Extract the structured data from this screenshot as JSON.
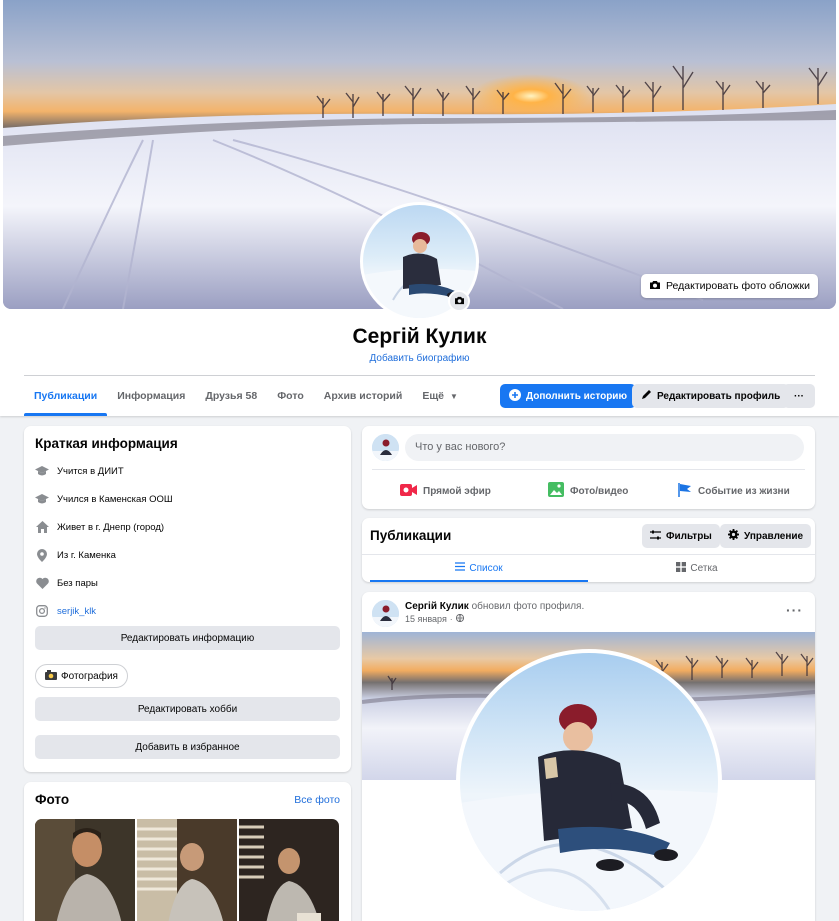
{
  "profile": {
    "name": "Сергій Кулик",
    "bio_link": "Добавить биографию",
    "edit_cover_label": "Редактировать фото обложки"
  },
  "tabs": [
    {
      "label": "Публикации"
    },
    {
      "label": "Информация"
    },
    {
      "label": "Друзья 58"
    },
    {
      "label": "Фото"
    },
    {
      "label": "Архив историй"
    },
    {
      "label": "Ещё"
    }
  ],
  "actions": {
    "add_story": "Дополнить историю",
    "edit_profile": "Редактировать профиль",
    "more": "···"
  },
  "intro": {
    "title": "Краткая информация",
    "items": [
      {
        "icon": "graduation-cap-icon",
        "text": "Учится в ДИИТ"
      },
      {
        "icon": "graduation-cap-icon",
        "text": "Учился в Каменская ООШ"
      },
      {
        "icon": "home-icon",
        "text": "Живет в г. Днепр (город)"
      },
      {
        "icon": "location-pin-icon",
        "text": "Из г. Каменка"
      },
      {
        "icon": "heart-icon",
        "text": "Без пары"
      },
      {
        "icon": "instagram-icon",
        "text": "serjik_klk"
      }
    ],
    "edit_info": "Редактировать информацию",
    "hobby_chip": "Фотография",
    "edit_hobbies": "Редактировать хобби",
    "add_featured": "Добавить в избранное"
  },
  "photos": {
    "title": "Фото",
    "all_link": "Все фото"
  },
  "composer": {
    "placeholder": "Что у вас нового?",
    "live": "Прямой эфир",
    "photo_video": "Фото/видео",
    "life_event": "Событие из жизни"
  },
  "publications": {
    "title": "Публикации",
    "filters": "Фильтры",
    "manage": "Управление",
    "list_view": "Список",
    "grid_view": "Сетка"
  },
  "post": {
    "author": "Сергій Кулик",
    "action": " обновил фото профиля.",
    "date": "15 января",
    "dots": "···"
  },
  "colors": {
    "accent": "#1877f2",
    "link": "#216fdb",
    "background": "#f0f2f5",
    "button_gray": "#e4e6eb"
  }
}
